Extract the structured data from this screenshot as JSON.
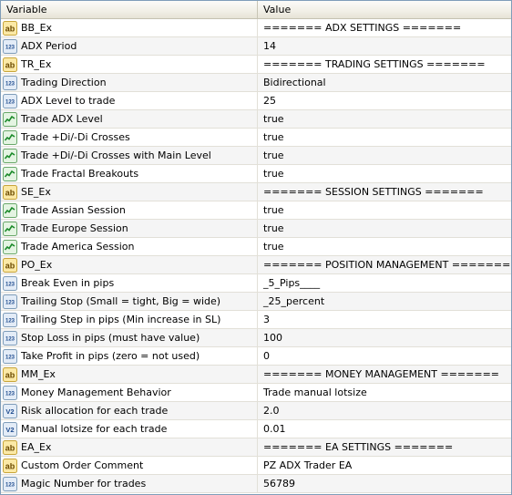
{
  "header": {
    "variable": "Variable",
    "value": "Value"
  },
  "rows": [
    {
      "label": "BB_Ex",
      "value": "======= ADX SETTINGS =======",
      "icon": "string-icon"
    },
    {
      "label": "ADX Period",
      "value": "14",
      "icon": "integer-icon"
    },
    {
      "label": "TR_Ex",
      "value": "======= TRADING SETTINGS =======",
      "icon": "string-icon"
    },
    {
      "label": "Trading Direction",
      "value": "Bidirectional",
      "icon": "integer-icon"
    },
    {
      "label": "ADX Level to trade",
      "value": "25",
      "icon": "integer-icon"
    },
    {
      "label": "Trade ADX Level",
      "value": "true",
      "icon": "boolean-icon"
    },
    {
      "label": "Trade +Di/-Di Crosses",
      "value": "true",
      "icon": "boolean-icon"
    },
    {
      "label": "Trade +Di/-Di Crosses with Main Level",
      "value": "true",
      "icon": "boolean-icon"
    },
    {
      "label": "Trade Fractal Breakouts",
      "value": "true",
      "icon": "boolean-icon"
    },
    {
      "label": "SE_Ex",
      "value": "======= SESSION SETTINGS =======",
      "icon": "string-icon"
    },
    {
      "label": "Trade Assian Session",
      "value": "true",
      "icon": "boolean-icon"
    },
    {
      "label": "Trade Europe Session",
      "value": "true",
      "icon": "boolean-icon"
    },
    {
      "label": "Trade America Session",
      "value": "true",
      "icon": "boolean-icon"
    },
    {
      "label": "PO_Ex",
      "value": "======= POSITION MANAGEMENT =======",
      "icon": "string-icon"
    },
    {
      "label": "Break Even in pips",
      "value": "_5_Pips____",
      "icon": "integer-icon"
    },
    {
      "label": "Trailing Stop (Small = tight, Big = wide)",
      "value": "_25_percent",
      "icon": "integer-icon"
    },
    {
      "label": "Trailing Step in pips (Min increase in SL)",
      "value": "3",
      "icon": "integer-icon"
    },
    {
      "label": "Stop Loss in pips (must have value)",
      "value": "100",
      "icon": "integer-icon"
    },
    {
      "label": "Take Profit in pips (zero = not used)",
      "value": "0",
      "icon": "integer-icon"
    },
    {
      "label": "MM_Ex",
      "value": "======= MONEY MANAGEMENT =======",
      "icon": "string-icon"
    },
    {
      "label": "Money Management Behavior",
      "value": "Trade manual lotsize",
      "icon": "integer-icon"
    },
    {
      "label": "Risk allocation for each trade",
      "value": "2.0",
      "icon": "double-icon"
    },
    {
      "label": "Manual lotsize for each trade",
      "value": "0.01",
      "icon": "double-icon"
    },
    {
      "label": "EA_Ex",
      "value": "======= EA SETTINGS =======",
      "icon": "string-icon"
    },
    {
      "label": "Custom Order Comment",
      "value": "PZ ADX Trader EA",
      "icon": "string-icon"
    },
    {
      "label": "Magic Number for trades",
      "value": "56789",
      "icon": "integer-icon"
    }
  ]
}
